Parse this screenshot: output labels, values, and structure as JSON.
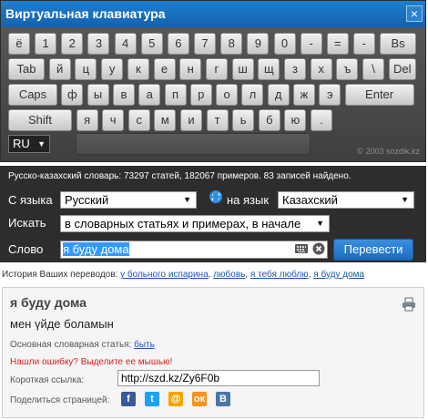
{
  "keyboard": {
    "title": "Виртуальная клавиатура",
    "close_label": "×",
    "rows": [
      [
        "ё",
        "1",
        "2",
        "3",
        "4",
        "5",
        "6",
        "7",
        "8",
        "9",
        "0",
        "-",
        "=",
        "-",
        "Bs"
      ],
      [
        "Tab",
        "й",
        "ц",
        "у",
        "к",
        "е",
        "н",
        "г",
        "ш",
        "щ",
        "з",
        "х",
        "ъ",
        "\\",
        "Del"
      ],
      [
        "Caps",
        "ф",
        "ы",
        "в",
        "а",
        "п",
        "р",
        "о",
        "л",
        "д",
        "ж",
        "э",
        "Enter"
      ],
      [
        "Shift",
        "я",
        "ч",
        "с",
        "м",
        "и",
        "т",
        "ь",
        "б",
        "ю",
        "."
      ]
    ],
    "lang": "RU",
    "copyright": "© 2003 sozdik.kz"
  },
  "search": {
    "stats": "Русско-казахский словарь:  73297 статей, 182067 примеров.  83 записей найдено.",
    "from_label": "С языка",
    "from_value": "Русский",
    "to_label": "на язык",
    "to_value": "Казахский",
    "search_label": "Искать",
    "search_value": "в словарных статьях и примерах, в начале",
    "word_label": "Слово",
    "word_value": "я буду дома",
    "translate_button": "Перевести"
  },
  "history": {
    "label": "История Ваших переводов:",
    "items": [
      "у больного испарина",
      "любовь",
      "я тебя люблю",
      "я буду дома"
    ]
  },
  "result": {
    "title": "я буду дома",
    "translation": "мен үйде боламын",
    "main_article_label": "Основная словарная статья:",
    "main_article_link": "быть",
    "error_note": "Нашли ошибку? Выделите ее мышью!",
    "short_link_label": "Короткая ссылка:",
    "short_link_value": "http://szd.kz/Zy6F0b",
    "share_label": "Поделиться страницей:",
    "share_icons": [
      {
        "name": "facebook-icon",
        "glyph": "f",
        "color": "#3b5998"
      },
      {
        "name": "twitter-icon",
        "glyph": "t",
        "color": "#1da1f2"
      },
      {
        "name": "mailru-icon",
        "glyph": "@",
        "color": "#f5a300"
      },
      {
        "name": "odnoklassniki-icon",
        "glyph": "ок",
        "color": "#f7931e"
      },
      {
        "name": "vkontakte-icon",
        "glyph": "В",
        "color": "#4a76a8"
      }
    ]
  }
}
